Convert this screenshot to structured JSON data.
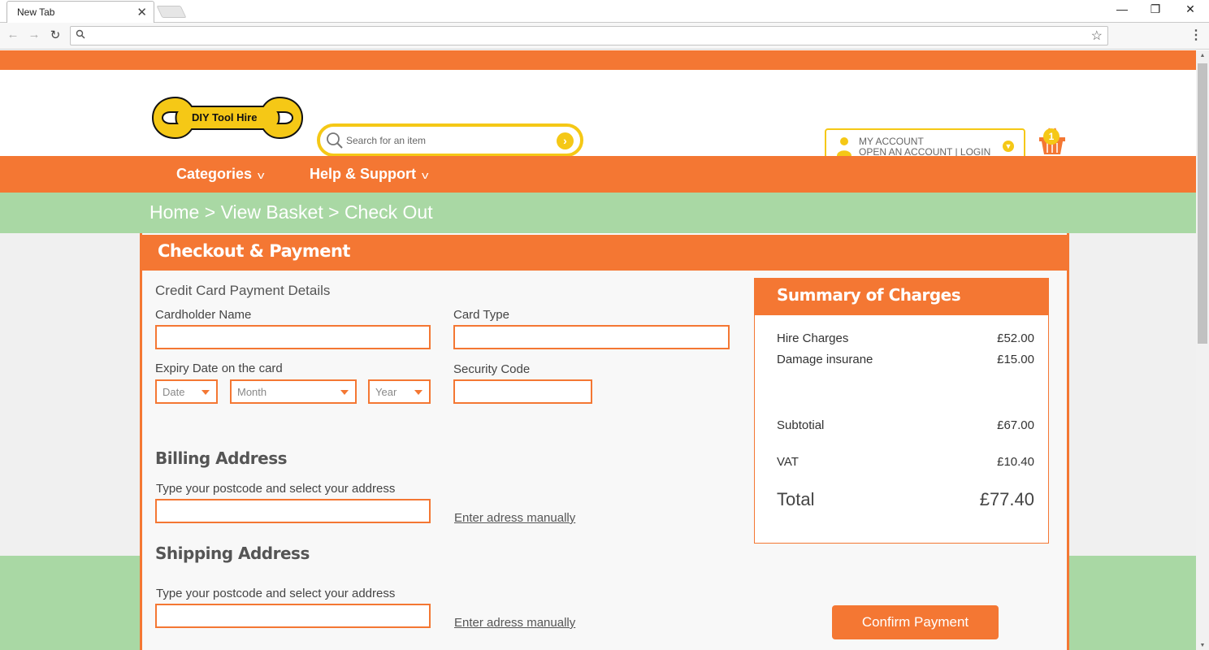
{
  "browser": {
    "tab_title": "New Tab",
    "url": ""
  },
  "site": {
    "logo_text": "DIY Tool Hire",
    "search_placeholder": "Search for an item",
    "account_line1": "MY ACCOUNT",
    "account_line2": "OPEN AN ACCOUNT | LOGIN",
    "basket_count": "1",
    "brand_orange": "#f47733",
    "brand_yellow": "#f5c816",
    "brand_green": "#a9d8a4"
  },
  "nav": {
    "categories": "Categories",
    "support": "Help & Support"
  },
  "breadcrumb": {
    "home": "Home",
    "basket": "View Basket",
    "checkout": "Check Out",
    "separator": ">"
  },
  "checkout": {
    "title": "Checkout & Payment",
    "card_section": "Credit Card Payment Details",
    "cardholder_label": "Cardholder Name",
    "card_type_label": "Card Type",
    "expiry_label": "Expiry Date on the card",
    "expiry_date": "Date",
    "expiry_month": "Month",
    "expiry_year": "Year",
    "security_label": "Security Code",
    "billing_title": "Billing Address",
    "billing_label": "Type your postcode and select your address",
    "billing_manual": "Enter adress manually",
    "shipping_title": "Shipping Address",
    "shipping_label": "Type your postcode and select your address",
    "shipping_manual": "Enter adress manually",
    "confirm": "Confirm Payment"
  },
  "summary": {
    "title": "Summary of Charges",
    "hire_label": "Hire Charges",
    "hire_value": "£52.00",
    "damage_label": "Damage insurane",
    "damage_value": "£15.00",
    "subtotal_label": "Subtotial",
    "subtotal_value": "£67.00",
    "vat_label": "VAT",
    "vat_value": "£10.40",
    "total_label": "Total",
    "total_value": "£77.40"
  }
}
